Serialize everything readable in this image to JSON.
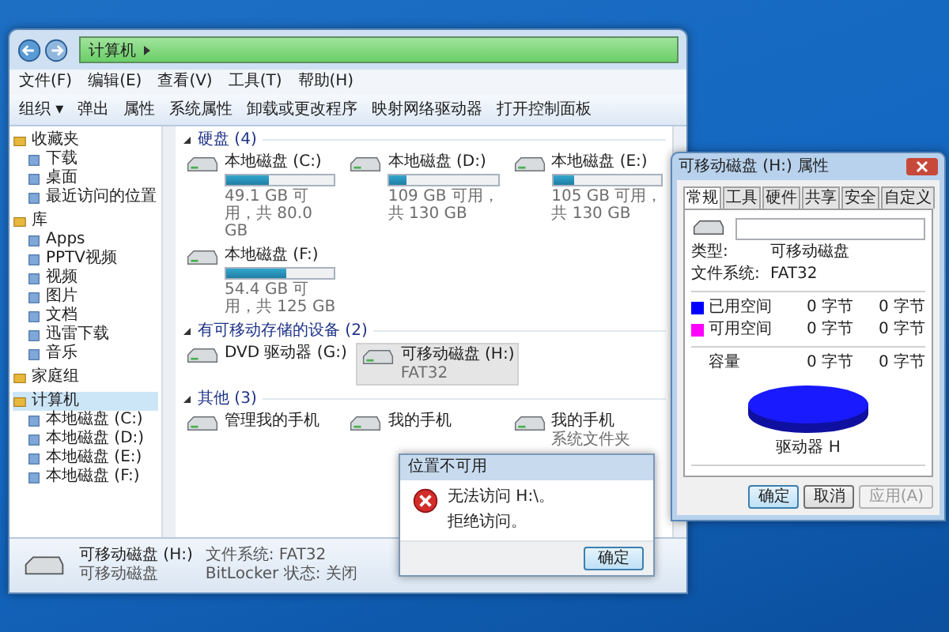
{
  "explorer": {
    "address": "计算机",
    "menu": [
      "文件(F)",
      "编辑(E)",
      "查看(V)",
      "工具(T)",
      "帮助(H)"
    ],
    "toolbar": [
      "组织 ▾",
      "弹出",
      "属性",
      "系统属性",
      "卸载或更改程序",
      "映射网络驱动器",
      "打开控制面板"
    ],
    "sidebar": [
      {
        "label": "收藏夹",
        "selected": false,
        "children": [
          {
            "label": "下载",
            "selected": false
          },
          {
            "label": "桌面",
            "selected": false
          },
          {
            "label": "最近访问的位置",
            "selected": false
          }
        ]
      },
      {
        "label": "库",
        "selected": false,
        "children": [
          {
            "label": "Apps",
            "selected": false
          },
          {
            "label": "PPTV视频",
            "selected": false
          },
          {
            "label": "视频",
            "selected": false
          },
          {
            "label": "图片",
            "selected": false
          },
          {
            "label": "文档",
            "selected": false
          },
          {
            "label": "迅雷下载",
            "selected": false
          },
          {
            "label": "音乐",
            "selected": false
          }
        ]
      },
      {
        "label": "家庭组",
        "selected": false
      },
      {
        "label": "计算机",
        "selected": true,
        "children": [
          {
            "label": "本地磁盘 (C:)",
            "selected": false
          },
          {
            "label": "本地磁盘 (D:)",
            "selected": false
          },
          {
            "label": "本地磁盘 (E:)",
            "selected": false
          },
          {
            "label": "本地磁盘 (F:)",
            "selected": false
          }
        ]
      }
    ],
    "sections": [
      {
        "title": "硬盘 (4)",
        "kind": "drives",
        "items": [
          {
            "name": "本地磁盘 (C:)",
            "level": 0.39,
            "detail": "49.1 GB 可用，共 80.0 GB",
            "selected": false
          },
          {
            "name": "本地磁盘 (D:)",
            "level": 0.16,
            "detail": "109 GB 可用，共 130 GB",
            "selected": false
          },
          {
            "name": "本地磁盘 (E:)",
            "level": 0.19,
            "detail": "105 GB 可用，共 130 GB",
            "selected": false
          },
          {
            "name": "本地磁盘 (F:)",
            "level": 0.56,
            "detail": "54.4 GB 可用，共 125 GB",
            "selected": false
          }
        ]
      },
      {
        "title": "有可移动存储的设备 (2)",
        "kind": "devices",
        "items": [
          {
            "name": "DVD 驱动器 (G:)",
            "selected": false
          },
          {
            "name": "可移动磁盘 (H:)",
            "detail": "FAT32",
            "selected": true
          }
        ]
      },
      {
        "title": "其他 (3)",
        "kind": "devices",
        "items": [
          {
            "name": "管理我的手机",
            "selected": false
          },
          {
            "name": "我的手机",
            "selected": false
          },
          {
            "name": "我的手机",
            "detail": "系统文件夹",
            "selected": false
          }
        ]
      }
    ],
    "details": {
      "name": "可移动磁盘 (H:)",
      "type": "可移动磁盘",
      "fields": [
        {
          "label": "文件系统:",
          "value": "FAT32"
        },
        {
          "label": "BitLocker 状态:",
          "value": "关闭"
        }
      ]
    }
  },
  "error_dialog": {
    "title": "位置不可用",
    "message": "无法访问 H:\\。",
    "detail": "拒绝访问。",
    "button": "确定"
  },
  "properties": {
    "title": "可移动磁盘 (H:) 属性",
    "tabs": [
      {
        "label": "常规",
        "selected": true
      },
      {
        "label": "工具",
        "selected": false
      },
      {
        "label": "硬件",
        "selected": false
      },
      {
        "label": "共享",
        "selected": false
      },
      {
        "label": "安全",
        "selected": false
      },
      {
        "label": "自定义",
        "selected": false
      }
    ],
    "info": [
      {
        "label": "类型:",
        "value": "可移动磁盘"
      },
      {
        "label": "文件系统:",
        "value": "FAT32"
      }
    ],
    "space": [
      {
        "label": "已用空间",
        "color": "#0000ff",
        "bytes": "0 字节",
        "size": "0 字节"
      },
      {
        "label": "可用空间",
        "color": "#ff00ff",
        "bytes": "0 字节",
        "size": "0 字节"
      }
    ],
    "capacity": {
      "label": "容量",
      "bytes": "0 字节",
      "size": "0 字节"
    },
    "drive_label": "驱动器 H",
    "buttons": [
      {
        "label": "确定",
        "disabled": false
      },
      {
        "label": "取消",
        "disabled": false
      },
      {
        "label": "应用(A)",
        "disabled": true
      }
    ]
  }
}
